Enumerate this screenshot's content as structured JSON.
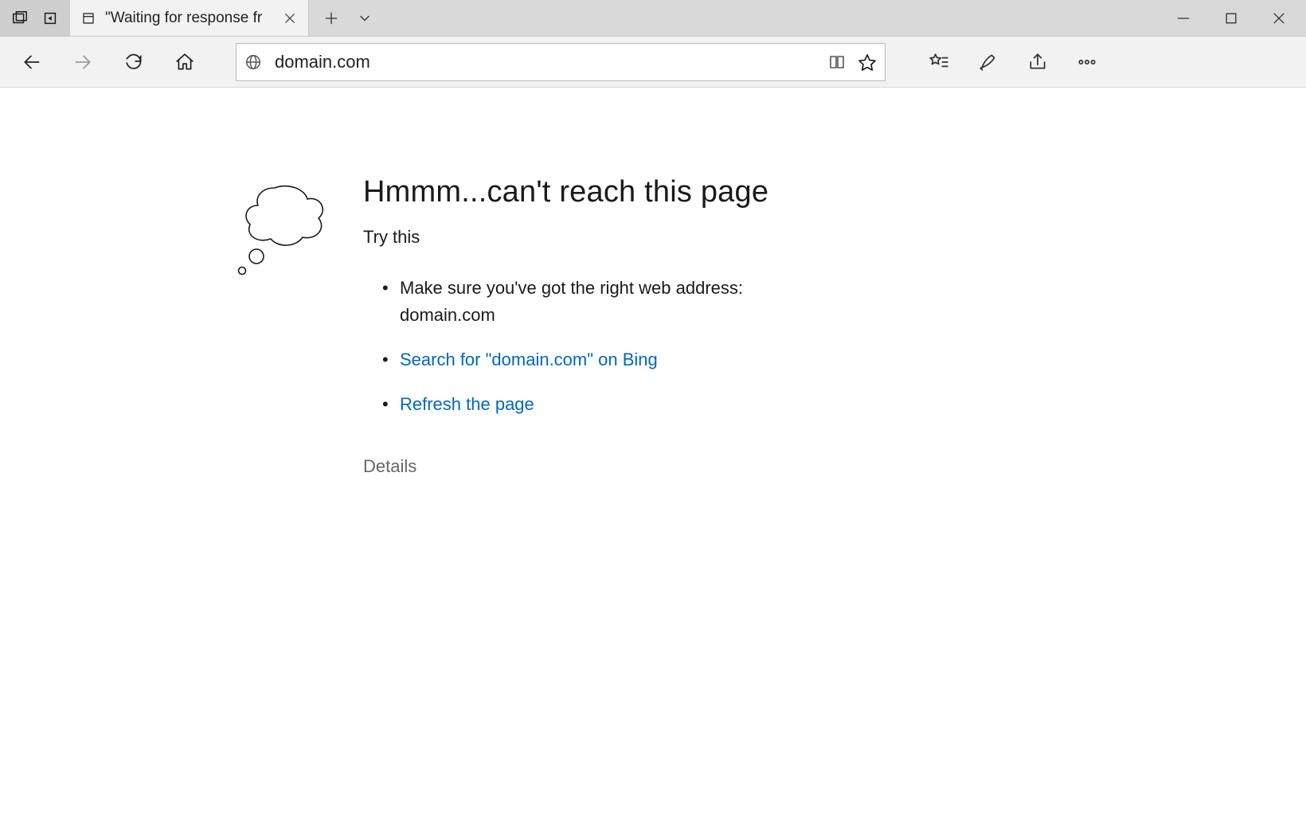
{
  "titlebar": {
    "tab_title": "\"Waiting for response fr"
  },
  "toolbar": {
    "url": "domain.com"
  },
  "error": {
    "title": "Hmmm...can't reach this page",
    "subtitle": "Try this",
    "suggestions": {
      "item0": "Make sure you've got the right web address: domain.com",
      "item1": "Search for \"domain.com\" on Bing",
      "item2": "Refresh the page"
    },
    "details_label": "Details"
  }
}
